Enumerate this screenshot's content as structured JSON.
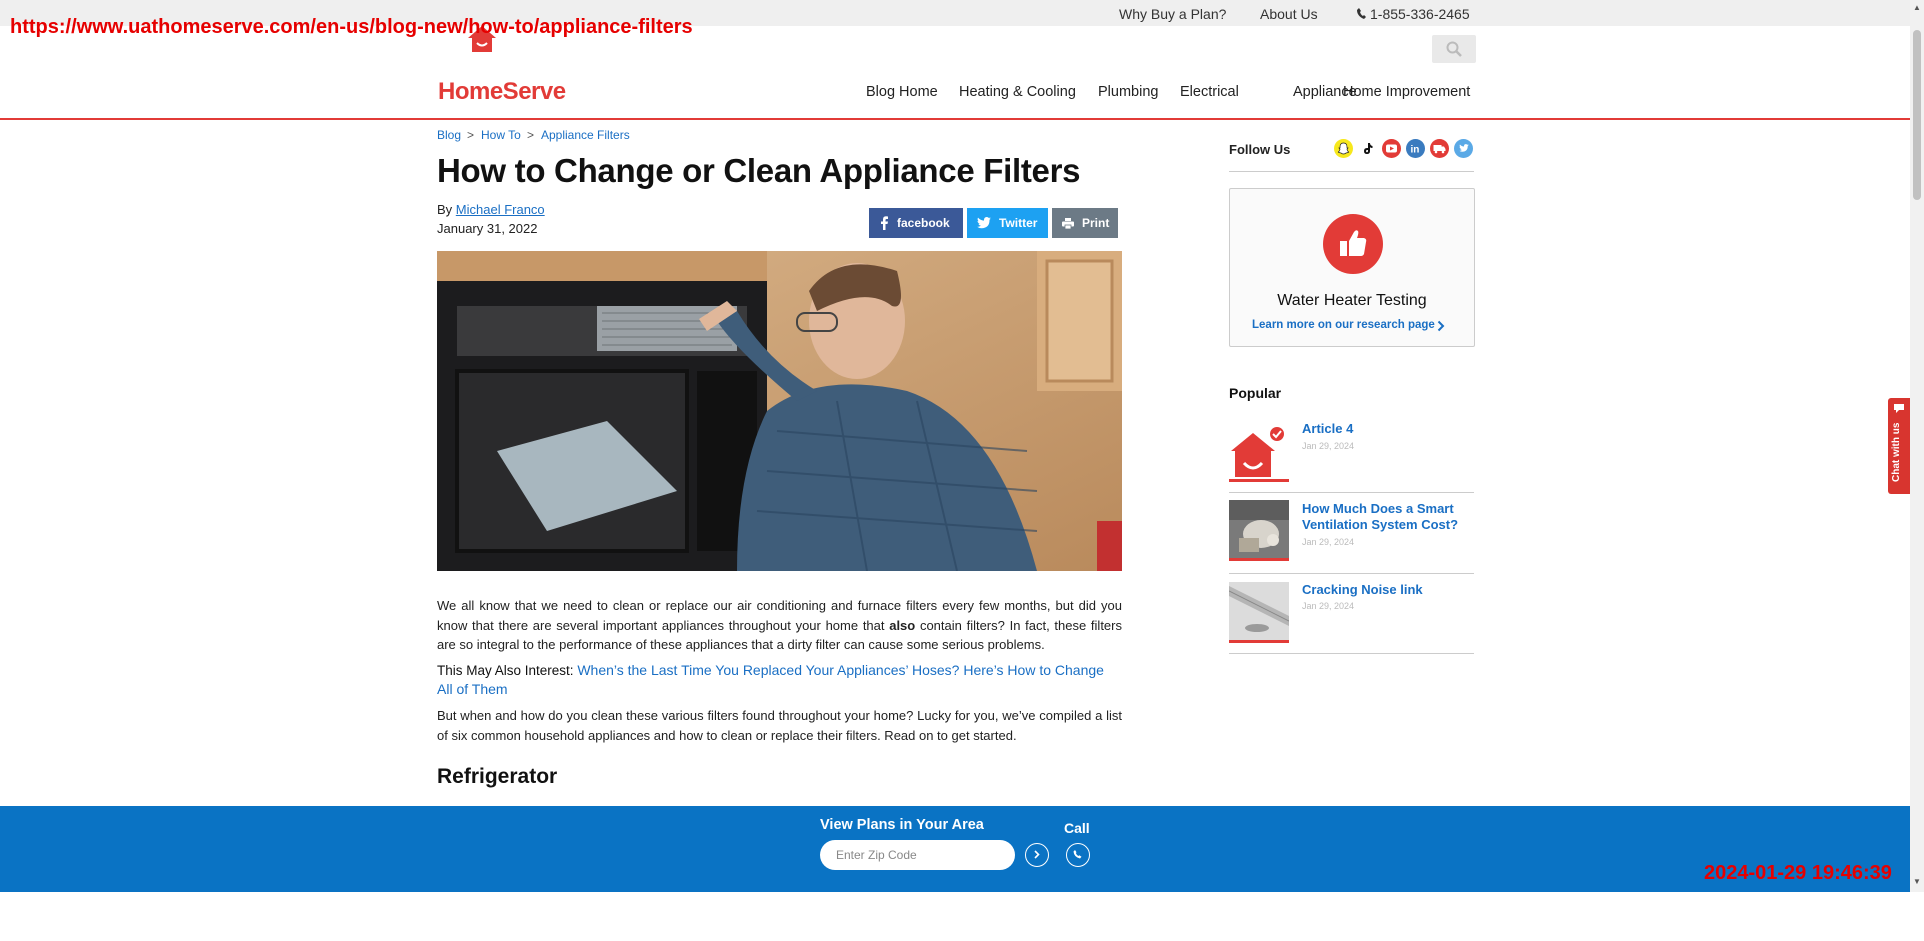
{
  "overlay": {
    "url": "https://www.uathomeserve.com/en-us/blog-new/how-to/appliance-filters",
    "timestamp": "2024-01-29 19:46:39"
  },
  "utility_nav": {
    "why_buy": "Why Buy a Plan?",
    "about": "About Us",
    "phone": "1-855-336-2465"
  },
  "logo": {
    "text": "HomeServe"
  },
  "main_nav": [
    "Blog Home",
    "Heating & Cooling",
    "Plumbing",
    "Electrical",
    "Appliance",
    "Home Improvement"
  ],
  "breadcrumb": [
    "Blog",
    "How To",
    "Appliance Filters"
  ],
  "article": {
    "title": "How to Change or Clean Appliance Filters",
    "by_label": "By",
    "author": "Michael Franco",
    "date": "January 31, 2022",
    "share": {
      "facebook": "facebook",
      "twitter": "Twitter",
      "print": "Print"
    },
    "para1_before": "We all know that we need to clean or replace our air conditioning and furnace filters every few months, but did you know that there are several important appliances throughout your home that ",
    "para1_em": "also",
    "para1_after": " contain filters? In fact, these filters are so integral to the performance of these appliances that a dirty filter can cause some serious problems.",
    "interest_label": "This May Also Interest: ",
    "interest_link": "When’s the Last Time You Replaced Your Appliances’ Hoses? Here’s How to Change All of Them",
    "para2": "But when and how do you clean these various filters found throughout your home? Lucky for you, we’ve compiled a list of six common household appliances and how to clean or replace their filters. Read on to get started.",
    "section_heading": "Refrigerator"
  },
  "sidebar": {
    "follow_label": "Follow Us",
    "social_icons": [
      {
        "name": "snapchat-icon",
        "color": "#f7e81c"
      },
      {
        "name": "tiktok-icon",
        "color": "#ffffff"
      },
      {
        "name": "youtube-icon",
        "color": "#e23b37"
      },
      {
        "name": "linkedin-icon",
        "color": "#3a7bbf"
      },
      {
        "name": "truck-icon",
        "color": "#e23b37"
      },
      {
        "name": "twitter-icon",
        "color": "#5aa9e6"
      }
    ],
    "card": {
      "title": "Water Heater Testing",
      "link": "Learn more on our research page"
    },
    "popular_heading": "Popular",
    "popular": [
      {
        "title": "Article 4",
        "date": "Jan 29, 2024"
      },
      {
        "title": "How Much Does a Smart Ventilation System Cost?",
        "date": "Jan 29, 2024"
      },
      {
        "title": "Cracking Noise link",
        "date": "Jan 29, 2024"
      }
    ]
  },
  "chat": {
    "label": "Chat with us"
  },
  "bottom_bar": {
    "view_plans": "View Plans in Your Area",
    "zip_placeholder": "Enter Zip Code",
    "call_label": "Call"
  },
  "colors": {
    "brand_red": "#e23b37",
    "link_blue": "#1a6fc4",
    "bottom_bar_blue": "#0a73c4",
    "facebook": "#3b5998",
    "twitter": "#1da1f2",
    "print": "#6c7a86"
  }
}
